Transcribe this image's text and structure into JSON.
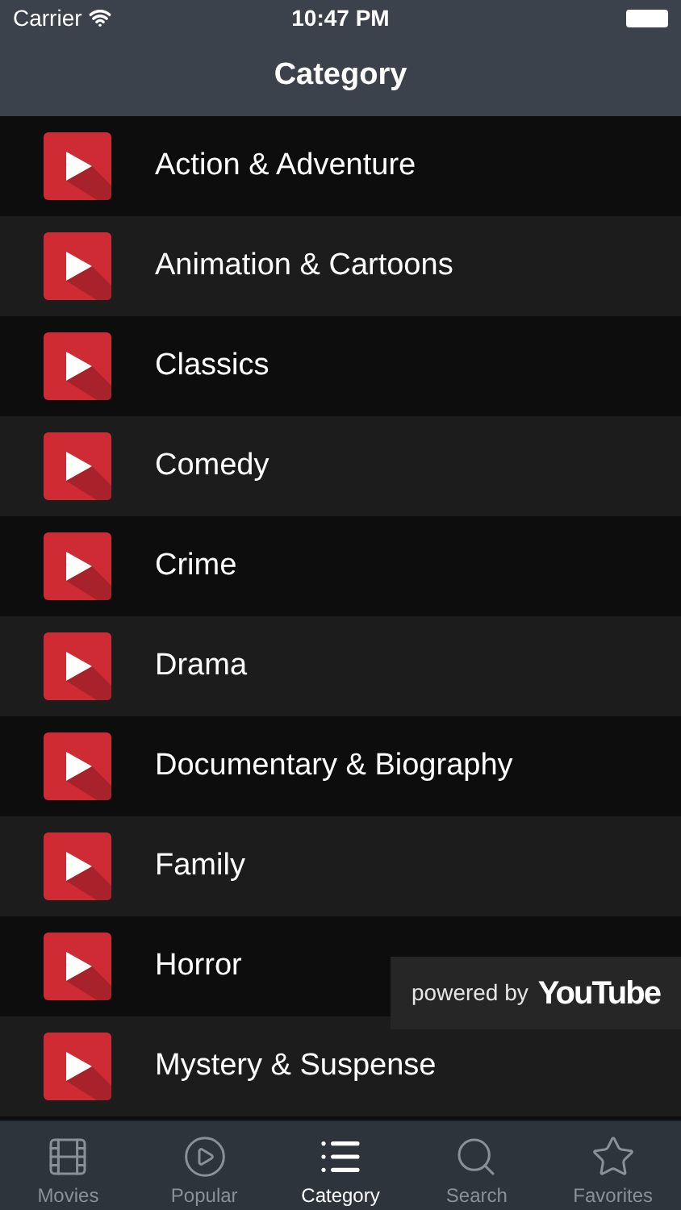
{
  "status_bar": {
    "carrier": "Carrier",
    "time": "10:47 PM"
  },
  "nav_bar": {
    "title": "Category"
  },
  "categories": [
    {
      "label": "Action & Adventure"
    },
    {
      "label": "Animation & Cartoons"
    },
    {
      "label": "Classics"
    },
    {
      "label": "Comedy"
    },
    {
      "label": "Crime"
    },
    {
      "label": "Drama"
    },
    {
      "label": "Documentary & Biography"
    },
    {
      "label": "Family"
    },
    {
      "label": "Horror"
    },
    {
      "label": "Mystery & Suspense"
    }
  ],
  "overlay": {
    "prefix": "powered by",
    "brand": "YouTube"
  },
  "tab_bar": [
    {
      "kind": "film",
      "label": "Movies",
      "selected": false
    },
    {
      "kind": "play",
      "label": "Popular",
      "selected": false
    },
    {
      "kind": "list",
      "label": "Category",
      "selected": true
    },
    {
      "kind": "search",
      "label": "Search",
      "selected": false
    },
    {
      "kind": "star",
      "label": "Favorites",
      "selected": false
    }
  ]
}
